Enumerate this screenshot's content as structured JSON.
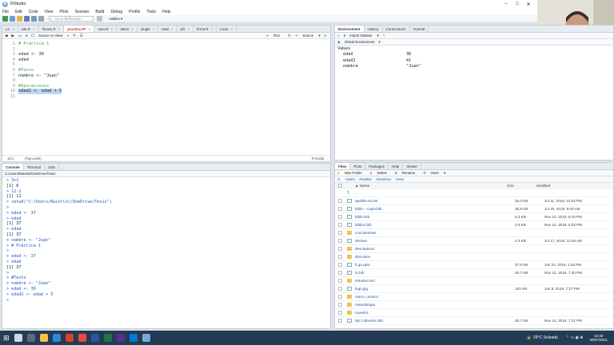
{
  "app": {
    "title": "RStudio"
  },
  "window_controls": [
    "–",
    "□",
    "✕"
  ],
  "menu": [
    "File",
    "Edit",
    "Code",
    "View",
    "Plots",
    "Session",
    "Build",
    "Debug",
    "Profile",
    "Tools",
    "Help"
  ],
  "toolbar": {
    "goto_placeholder": "Go to file/function",
    "addins": "Addins"
  },
  "editor": {
    "tabs": [
      {
        "label": "Lo"
      },
      {
        "label": "vile.R"
      },
      {
        "label": "firma1.R"
      },
      {
        "label": "practica.R*",
        "active": true
      },
      {
        "label": "sara.R"
      },
      {
        "label": "datos"
      },
      {
        "label": "single"
      },
      {
        "label": "total"
      },
      {
        "label": "pfs"
      },
      {
        "label": "firma.R"
      },
      {
        "label": "inicia"
      }
    ],
    "source_on_save": "Source on Save",
    "run": "Run",
    "source": "Source",
    "lines": [
      {
        "n": "1",
        "text": "# Práctica 1",
        "cls": "cmt"
      },
      {
        "n": "2",
        "text": "",
        "cls": ""
      },
      {
        "n": "3",
        "text": "edad <- 36",
        "cls": ""
      },
      {
        "n": "4",
        "text": "edad",
        "cls": ""
      },
      {
        "n": "5",
        "text": "",
        "cls": ""
      },
      {
        "n": "6",
        "text": "#Texto",
        "cls": "cmt"
      },
      {
        "n": "7",
        "text": "nombre <- \"Juan\"",
        "cls": ""
      },
      {
        "n": "8",
        "text": "",
        "cls": ""
      },
      {
        "n": "9",
        "text": "#Operaciones",
        "cls": "cmt"
      },
      {
        "n": "10",
        "text": "edad2 <- edad + 5",
        "cls": "sel"
      },
      {
        "n": "11",
        "text": "",
        "cls": ""
      }
    ],
    "status": {
      "pos": "10:1",
      "scope": "(Top Level)",
      "type": "R Script"
    }
  },
  "console": {
    "tabs": [
      "Console",
      "Terminal",
      "Jobs"
    ],
    "path": "C:/Users/Raistlol/OneDrive/Tesis/",
    "lines": [
      {
        "t": "> 3+1",
        "p": true
      },
      {
        "t": "[1] 6",
        "p": false
      },
      {
        "t": "> 12-1",
        "p": true
      },
      {
        "t": "[1] 11",
        "p": false
      },
      {
        "t": "> setwd(\"C:/Users/Raistlol/OneDrive/Tesis\")",
        "p": true
      },
      {
        "t": ">",
        "p": true
      },
      {
        "t": "> edad <- 37",
        "p": true
      },
      {
        "t": "> edad",
        "p": true
      },
      {
        "t": "[1] 37",
        "p": false
      },
      {
        "t": "> edad",
        "p": true
      },
      {
        "t": "[1] 37",
        "p": false
      },
      {
        "t": "> nombre <- \"Juan\"",
        "p": true
      },
      {
        "t": "> # Práctica 1",
        "p": true
      },
      {
        "t": ">",
        "p": true
      },
      {
        "t": "> edad <- 37",
        "p": true
      },
      {
        "t": "> edad",
        "p": true
      },
      {
        "t": "[1] 37",
        "p": false
      },
      {
        "t": ">",
        "p": true
      },
      {
        "t": "> #Texto",
        "p": true
      },
      {
        "t": "> nombre <- \"Juan\"",
        "p": true
      },
      {
        "t": "> edad <- 36",
        "p": true
      },
      {
        "t": "> edad2 <- edad + 5",
        "p": true
      },
      {
        "t": ">",
        "p": true
      }
    ]
  },
  "environment": {
    "tabs": [
      "Environment",
      "History",
      "Connections",
      "Tutorial"
    ],
    "import": "Import Dataset",
    "scope": "Global Environment",
    "section": "Values",
    "values": [
      {
        "name": "edad",
        "value": "36"
      },
      {
        "name": "edad2",
        "value": "41"
      },
      {
        "name": "nombre",
        "value": "\"Juan\""
      }
    ]
  },
  "files": {
    "tabs": [
      "Files",
      "Plots",
      "Packages",
      "Help",
      "Viewer"
    ],
    "toolbar": {
      "new_folder": "New Folder",
      "delete": "Delete",
      "rename": "Rename",
      "more": "More"
    },
    "breadcrumb": [
      "C:",
      "Users",
      "Raistlol",
      "OneDrive",
      "Tesis"
    ],
    "headers": {
      "name": "Name",
      "size": "Size",
      "modified": "Modified"
    },
    "up": "..",
    "rows": [
      {
        "name": "apalike-es.bst",
        "type": "doc",
        "size": "26.3 KB",
        "modified": "Jul 11, 2019, 12:53 PM"
      },
      {
        "name": "biblio - copia.bib",
        "type": "doc",
        "size": "38.8 KB",
        "modified": "Jul 20, 2019, 9:40 AM"
      },
      {
        "name": "biblio.bib",
        "type": "doc",
        "size": "6.2 KB",
        "modified": "Nov 12, 2019, 8:10 PM"
      },
      {
        "name": "biblio1.bib",
        "type": "doc",
        "size": "2.9 KB",
        "modified": "Nov 12, 2019, 6:53 PM"
      },
      {
        "name": "conclusiones",
        "type": "folder",
        "size": "",
        "modified": ""
      },
      {
        "name": "declare",
        "type": "doc",
        "size": "2.3 KB",
        "modified": "Jul 17, 2018, 12:48 AM"
      },
      {
        "name": "descriptivos",
        "type": "folder",
        "size": "",
        "modified": ""
      },
      {
        "name": "discusion",
        "type": "folder",
        "size": "",
        "modified": ""
      },
      {
        "name": "ft.go.pptx",
        "type": "doc",
        "size": "37.6 KB",
        "modified": "Jan 22, 2019, 1:53 PM"
      },
      {
        "name": "fu.bib",
        "type": "doc",
        "size": "45.7 KB",
        "modified": "Nov 12, 2019, 7:30 PM"
      },
      {
        "name": "introduccion",
        "type": "folder",
        "size": "",
        "modified": ""
      },
      {
        "name": "logo.jpg",
        "type": "doc",
        "size": "193 KB",
        "modified": "Jan 8, 2019, 7:27 PM"
      },
      {
        "name": "marco_teorico",
        "type": "folder",
        "size": "",
        "modified": ""
      },
      {
        "name": "metodologia",
        "type": "folder",
        "size": "",
        "modified": ""
      },
      {
        "name": "muestra",
        "type": "folder",
        "size": "",
        "modified": ""
      },
      {
        "name": "My Collection.bib",
        "type": "doc",
        "size": "45.7 KB",
        "modified": "Nov 12, 2019, 7:31 PM"
      }
    ]
  },
  "taskbar": {
    "weather": "29°C Soleado",
    "time": "12:40",
    "date": "20/07/2021",
    "colors": {
      "bg": "#243b55"
    }
  }
}
